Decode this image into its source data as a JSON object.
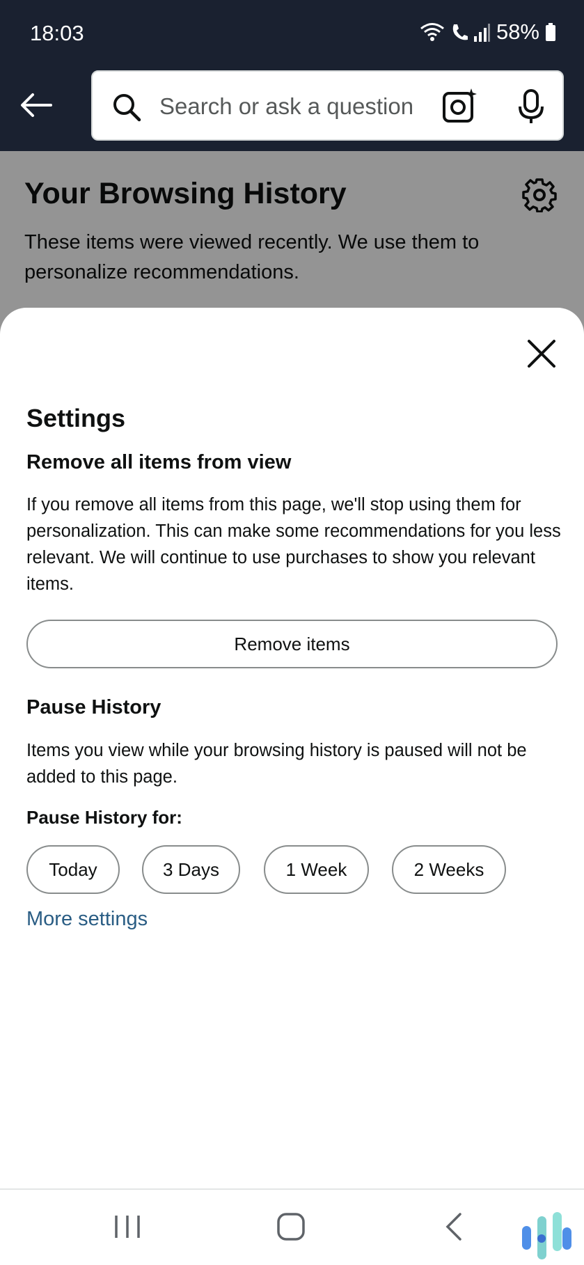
{
  "status_bar": {
    "time": "18:03",
    "battery": "58%"
  },
  "search": {
    "placeholder": "Search or ask a question"
  },
  "page": {
    "title": "Your Browsing History",
    "description": "These items were viewed recently. We use them to personalize recommendations."
  },
  "settings_sheet": {
    "title": "Settings",
    "remove": {
      "heading": "Remove all items from view",
      "description": "If you remove all items from this page, we'll stop using them for personalization. This can make some recommendations for you less relevant. We will continue to use purchases to show you relevant items.",
      "button_label": "Remove items"
    },
    "pause": {
      "heading": "Pause History",
      "description": "Items you view while your browsing history is paused will not be added to this page.",
      "for_label": "Pause History for:",
      "options": [
        "Today",
        "3 Days",
        "1 Week",
        "2 Weeks"
      ]
    },
    "more_settings_label": "More settings"
  },
  "colors": {
    "header_bg": "#1a2130",
    "link": "#2a5d84",
    "button_border": "#888c8c"
  },
  "icons": [
    "back-arrow-icon",
    "search-icon",
    "camera-icon",
    "microphone-icon",
    "gear-icon",
    "close-icon",
    "nav-recents-icon",
    "nav-home-icon",
    "nav-back-icon"
  ]
}
